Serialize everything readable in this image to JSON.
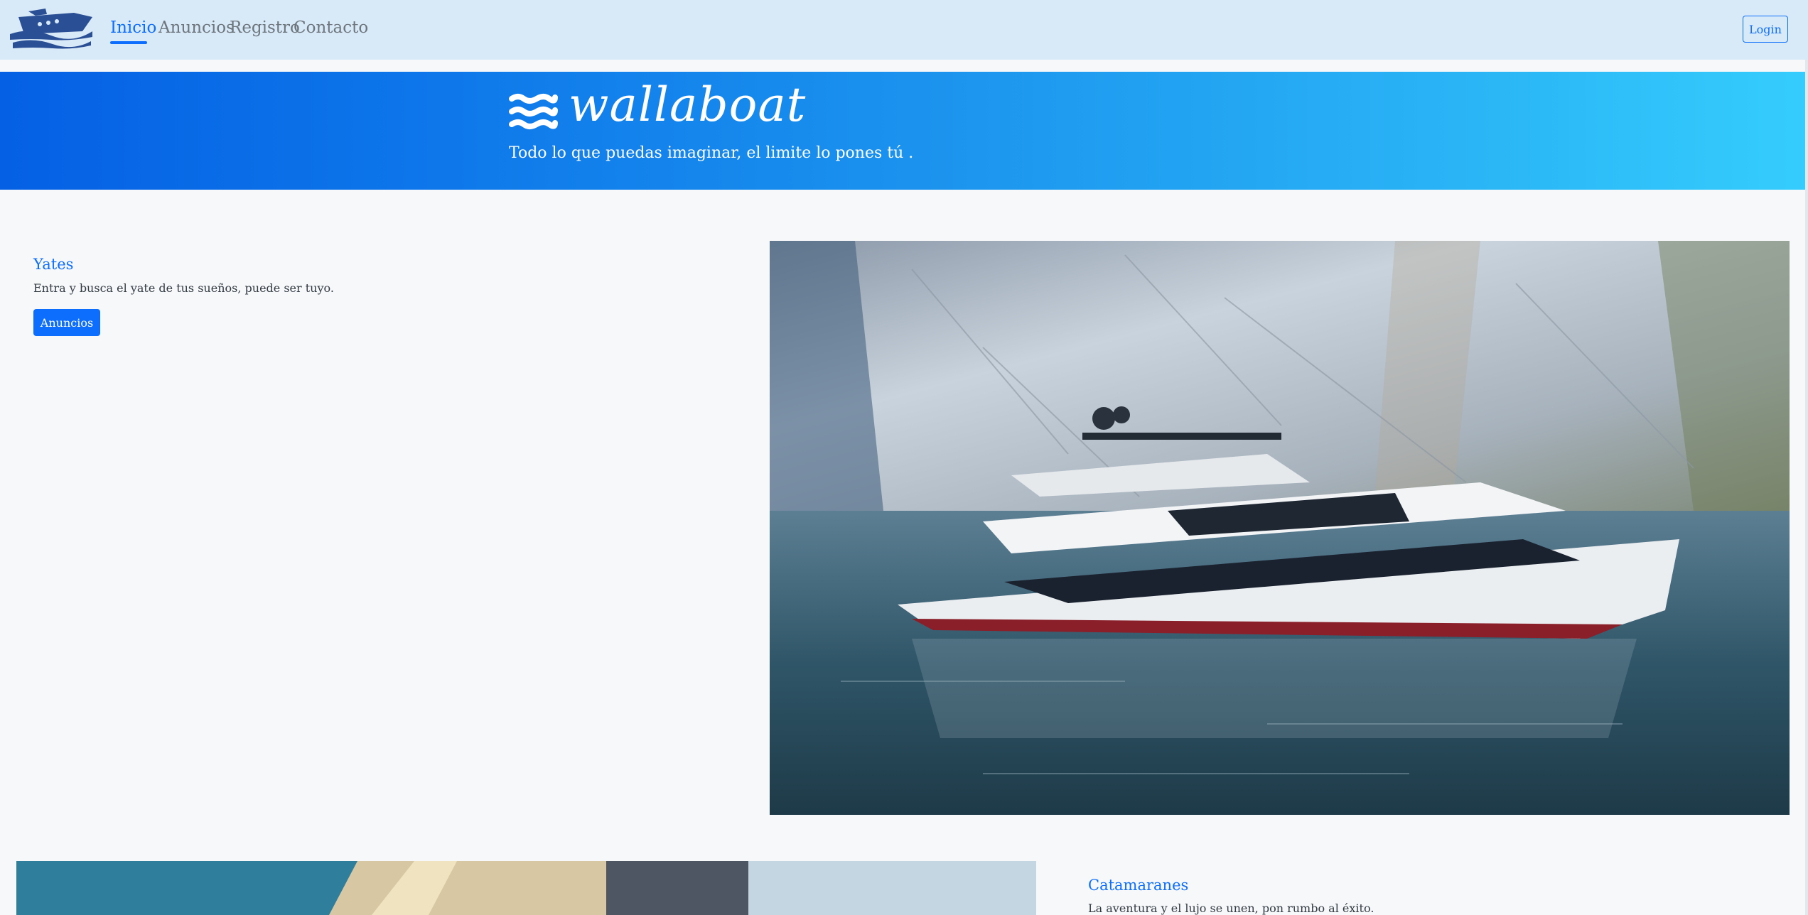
{
  "nav": {
    "logo_icon": "boat-logo-icon",
    "links": [
      {
        "label": "Inicio",
        "active": true
      },
      {
        "label": "Anuncios",
        "active": false
      },
      {
        "label": "Registro",
        "active": false
      },
      {
        "label": "Contacto",
        "active": false
      }
    ],
    "login_label": "Login"
  },
  "hero": {
    "icon": "waves-icon",
    "brand": "wallaboat",
    "subtitle": "Todo lo que puedas imaginar, el limite lo pones tú ."
  },
  "sections": [
    {
      "title": "Yates",
      "text": "Entra y busca el yate de tus sueños, puede ser tuyo.",
      "button_label": "Anuncios",
      "image": "yacht-photo"
    },
    {
      "title": "Catamaranes",
      "text": "La aventura y el lujo se unen, pon rumbo al éxito.",
      "image": "catamaran-photo"
    }
  ],
  "colors": {
    "primary": "#0d6efd",
    "navbar_bg": "#d8e9f7",
    "hero_start": "#0560e4",
    "hero_end": "#35cdfd",
    "page_bg": "#f6f8fa"
  }
}
